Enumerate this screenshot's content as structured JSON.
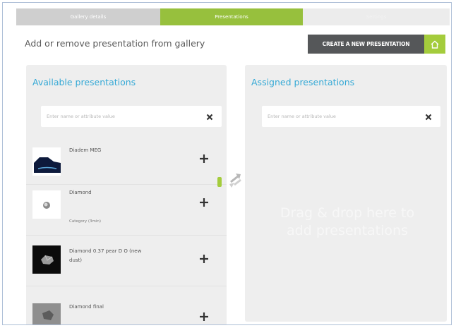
{
  "tabs": [
    {
      "label": "Gallery details"
    },
    {
      "label": "Presentations"
    },
    {
      "label": "Settings"
    }
  ],
  "header": {
    "text": "Add or remove presentation from gallery",
    "create_button_label": "CREATE A NEW PRESENTATION"
  },
  "available": {
    "title": "Available presentations",
    "search_placeholder": "Enter name or attribute value",
    "items": [
      {
        "name": "Diadem MEG",
        "category": ""
      },
      {
        "name": "Diamond",
        "category": "Category (3min)"
      },
      {
        "name": "Diamond 0.37 pear D O (new dust)",
        "category": ""
      },
      {
        "name": "Diamond final",
        "category": ""
      }
    ]
  },
  "assigned": {
    "title": "Assigned presentations",
    "search_placeholder": "Enter name or attribute value",
    "empty_hint": "Drag & drop here to add presentations"
  },
  "colors": {
    "accent_green": "#a4cc3c",
    "tab_active": "#97c03d",
    "title_blue": "#35a9d6",
    "dark_button": "#555759",
    "panel_bg": "#eeeeee"
  },
  "icons": [
    "plus-icon",
    "close-icon",
    "swap-arrows-icon",
    "home-icon"
  ]
}
